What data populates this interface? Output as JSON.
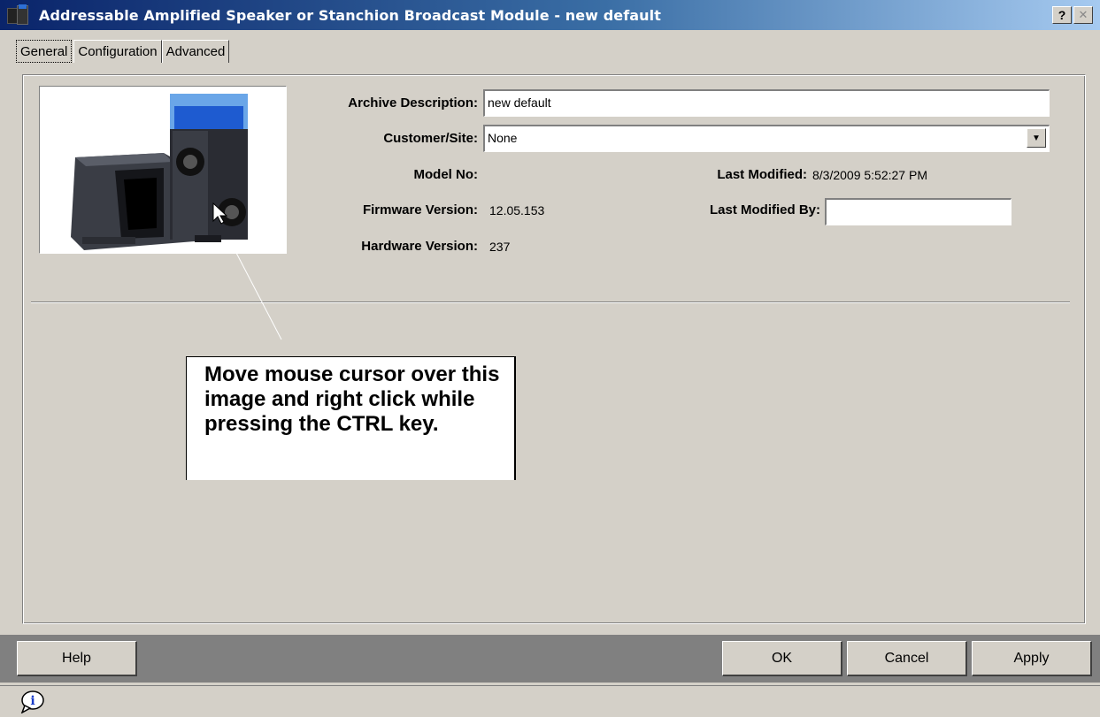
{
  "window": {
    "title": "Addressable Amplified Speaker or Stanchion Broadcast Module - new default",
    "help_glyph": "?",
    "close_glyph": "✕"
  },
  "tabs": [
    {
      "label": "General",
      "active": true
    },
    {
      "label": "Configuration",
      "active": false
    },
    {
      "label": "Advanced",
      "active": false
    }
  ],
  "general": {
    "archive_description_label": "Archive Description:",
    "archive_description_value": "new default",
    "customer_site_label": "Customer/Site:",
    "customer_site_value": "None",
    "model_no_label": "Model No:",
    "model_no_value": "",
    "firmware_version_label": "Firmware Version:",
    "firmware_version_value": "12.05.153",
    "hardware_version_label": "Hardware Version:",
    "hardware_version_value": "237",
    "last_modified_label": "Last Modified:",
    "last_modified_value": "8/3/2009 5:52:27 PM",
    "last_modified_by_label": "Last Modified By:",
    "last_modified_by_value": ""
  },
  "callout": {
    "text": "Move mouse cursor over this image and right click while pressing the CTRL key."
  },
  "buttons": {
    "help": "Help",
    "ok": "OK",
    "cancel": "Cancel",
    "apply": "Apply"
  },
  "icons": {
    "app": "speaker-module-icon",
    "status": "info-balloon-icon",
    "dropdown": "chevron-down-icon"
  },
  "colors": {
    "titlebar_start": "#0a246a",
    "titlebar_end": "#a6caf0",
    "window_bg": "#d4d0c8",
    "beacon_blue": "#2d6fd6"
  }
}
